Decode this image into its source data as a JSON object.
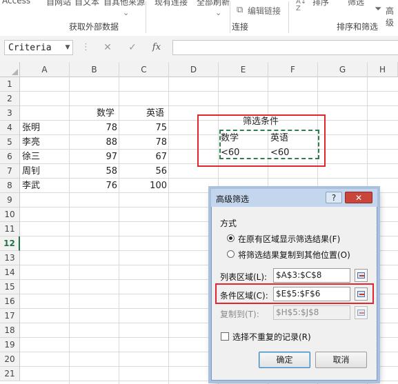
{
  "ribbon": {
    "top_items": [
      "Access",
      "自网站",
      "自文本",
      "自其他来源",
      "现有连接",
      "全部刷新",
      "编辑链接",
      "排序",
      "筛选",
      "高级"
    ],
    "groups": [
      "获取外部数据",
      "连接",
      "排序和筛选"
    ]
  },
  "formula_bar": {
    "name_box": "Criteria",
    "fx_label": "fx",
    "cancel": "✕",
    "enter": "✓"
  },
  "columns": [
    "A",
    "B",
    "C",
    "D",
    "E",
    "F",
    "G",
    "H"
  ],
  "rows": [
    "1",
    "2",
    "3",
    "4",
    "5",
    "6",
    "7",
    "8",
    "9",
    "10",
    "11",
    "12",
    "13",
    "14",
    "15",
    "16",
    "17",
    "18",
    "19",
    "20",
    "21"
  ],
  "sheet": {
    "header": {
      "math": "数学",
      "english": "英语"
    },
    "records": [
      {
        "name": "张明",
        "math": "78",
        "english": "75"
      },
      {
        "name": "李亮",
        "math": "88",
        "english": "78"
      },
      {
        "name": "徐三",
        "math": "97",
        "english": "67"
      },
      {
        "name": "周钊",
        "math": "58",
        "english": "56"
      },
      {
        "name": "李武",
        "math": "76",
        "english": "100"
      }
    ],
    "criteria": {
      "title": "筛选条件",
      "h1": "数学",
      "h2": "英语",
      "v1": "<60",
      "v2": "<60"
    }
  },
  "dialog": {
    "title": "高级筛选",
    "help": "?",
    "close": "✕",
    "mode_label": "方式",
    "opt_inplace": "在原有区域显示筛选结果(F)",
    "opt_copy": "将筛选结果复制到其他位置(O)",
    "list_label": "列表区域(L):",
    "list_value": "$A$3:$C$8",
    "criteria_label": "条件区域(C):",
    "criteria_value": "$E$5:$F$6",
    "copyto_label": "复制到(T):",
    "copyto_value": "$H$5:$J$8",
    "unique_label": "选择不重复的记录(R)",
    "ok": "确定",
    "cancel": "取消"
  },
  "colors": {
    "highlight_red": "#e2252c",
    "marching_ants": "#2e7d4a",
    "excel_green": "#217346"
  }
}
